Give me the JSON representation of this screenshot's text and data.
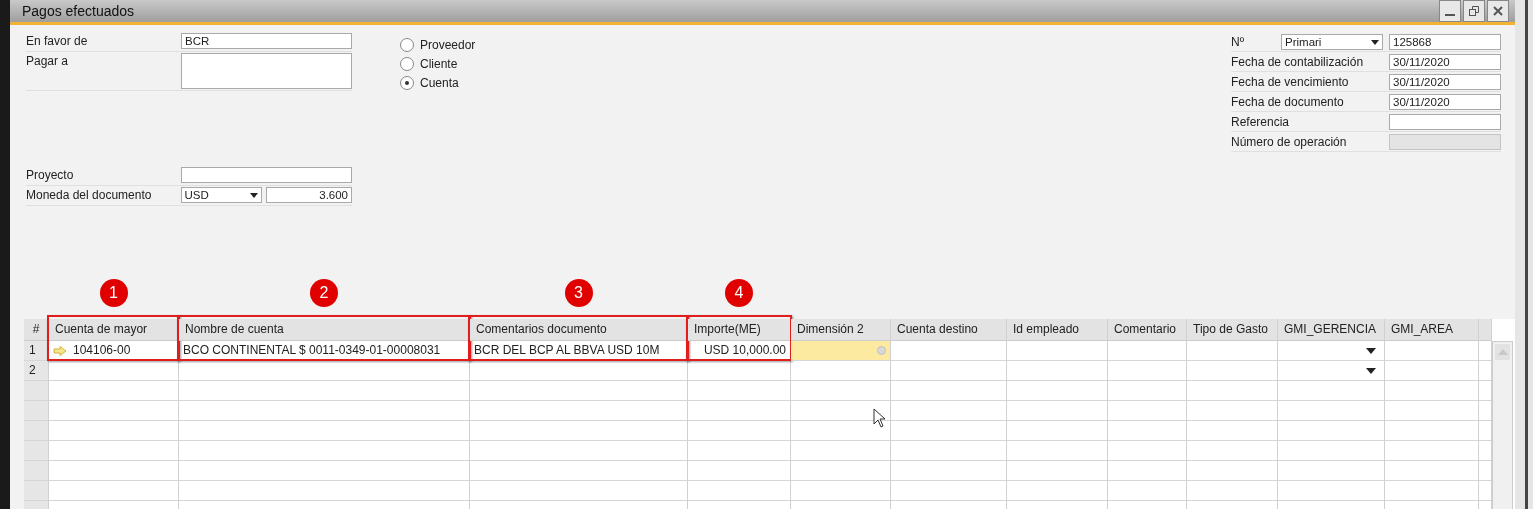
{
  "window": {
    "title": "Pagos efectuados"
  },
  "left_fields": [
    {
      "label": "En favor de",
      "kind": "input",
      "value": "BCR"
    },
    {
      "label": "Pagar a",
      "kind": "textarea"
    },
    {
      "label": "Proyecto",
      "kind": "input"
    },
    {
      "label": "Moneda del documento",
      "kind": "select_rate",
      "value": "USD",
      "rate": "3.600"
    }
  ],
  "radios": [
    {
      "label": "Proveedor",
      "selected": false
    },
    {
      "label": "Cliente",
      "selected": false
    },
    {
      "label": "Cuenta",
      "selected": true
    }
  ],
  "right_fields": [
    {
      "label": "Nº",
      "kind": "select_input",
      "option": "Primari",
      "value": "125868"
    },
    {
      "label": "Fecha de contabilización",
      "kind": "input",
      "value": "30/11/2020"
    },
    {
      "label": "Fecha de vencimiento",
      "kind": "input",
      "value": "30/11/2020"
    },
    {
      "label": "Fecha de documento",
      "kind": "input",
      "value": "30/11/2020"
    },
    {
      "label": "Referencia",
      "kind": "input"
    },
    {
      "label": "Número de operación",
      "kind": "input",
      "disabled": true
    }
  ],
  "table": {
    "number_header": "#",
    "columns": [
      {
        "label": "Cuenta de mayor",
        "highlighted": true,
        "callout": "1"
      },
      {
        "label": "Nombre de cuenta",
        "highlighted": true,
        "callout": "2"
      },
      {
        "label": "Comentarios documento",
        "highlighted": true,
        "callout": "3"
      },
      {
        "label": "Importe(ME)",
        "highlighted": true,
        "callout": "4"
      },
      {
        "label": "Dimensión 2",
        "highlighted": false
      },
      {
        "label": "Cuenta destino",
        "highlighted": false
      },
      {
        "label": "Id empleado",
        "highlighted": false
      },
      {
        "label": "Comentario",
        "highlighted": false
      },
      {
        "label": "Tipo de Gasto",
        "highlighted": false
      },
      {
        "label": "GMI_GERENCIA",
        "highlighted": false
      },
      {
        "label": "GMI_AREA",
        "highlighted": false
      }
    ],
    "rows": [
      {
        "number": "1",
        "current": true,
        "cells": [
          {
            "text": "104106-00",
            "focused": false,
            "dropdown": false
          },
          {
            "text": "BCO CONTINENTAL $ 0011-0349-01-00008031",
            "focused": false,
            "dropdown": false
          },
          {
            "text": "BCR DEL BCP AL BBVA USD 10M",
            "focused": false,
            "dropdown": false
          },
          {
            "text": "USD 10,000.00",
            "focused": false,
            "dropdown": false
          },
          {
            "focused": true,
            "dropdown": false
          },
          {
            "focused": false,
            "dropdown": false
          },
          {
            "focused": false,
            "dropdown": false
          },
          {
            "focused": false,
            "dropdown": false
          },
          {
            "focused": false,
            "dropdown": false
          },
          {
            "focused": false,
            "dropdown": true
          },
          {
            "focused": false,
            "dropdown": false
          }
        ]
      },
      {
        "number": "2",
        "current": false,
        "cells": [
          {
            "focused": false,
            "dropdown": false
          },
          {
            "focused": false,
            "dropdown": false
          },
          {
            "focused": false,
            "dropdown": false
          },
          {
            "focused": false,
            "dropdown": false
          },
          {
            "focused": false,
            "dropdown": false
          },
          {
            "focused": false,
            "dropdown": false
          },
          {
            "focused": false,
            "dropdown": false
          },
          {
            "focused": false,
            "dropdown": false
          },
          {
            "focused": false,
            "dropdown": false
          },
          {
            "focused": false,
            "dropdown": true
          },
          {
            "focused": false,
            "dropdown": false
          }
        ]
      }
    ]
  }
}
